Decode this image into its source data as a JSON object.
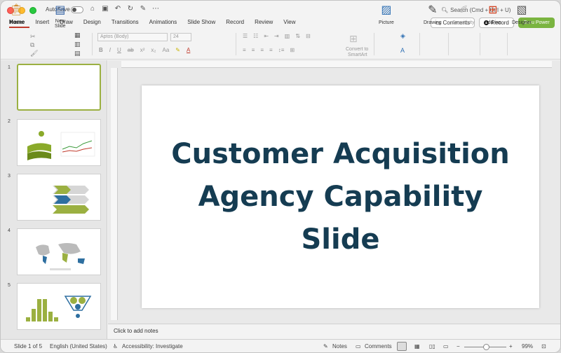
{
  "titlebar": {
    "autosave_label": "AutoSave",
    "search_placeholder": "Search (Cmd + Ctrl + U)"
  },
  "tabs": [
    {
      "label": "Home",
      "active": true
    },
    {
      "label": "Insert"
    },
    {
      "label": "Draw"
    },
    {
      "label": "Design"
    },
    {
      "label": "Transitions"
    },
    {
      "label": "Animations"
    },
    {
      "label": "Slide Show"
    },
    {
      "label": "Record"
    },
    {
      "label": "Review"
    },
    {
      "label": "View"
    }
  ],
  "top_buttons": {
    "comments": "Comments",
    "record": "Record",
    "guru": "Guru Power"
  },
  "ribbon": {
    "paste": "Paste",
    "new_slide_line1": "New",
    "new_slide_line2": "Slide",
    "font_name": "Aptos (Body)",
    "font_size": "24",
    "convert_line1": "Convert to",
    "convert_line2": "SmartArt",
    "picture": "Picture",
    "drawing": "Drawing",
    "sensitivity": "Sensitivity",
    "addins": "Add-ins",
    "designer": "Designer"
  },
  "slides": [
    {
      "number": "1"
    },
    {
      "number": "2"
    },
    {
      "number": "3"
    },
    {
      "number": "4"
    },
    {
      "number": "5"
    }
  ],
  "slide": {
    "title_line1": "Customer Acquisition",
    "title_line2": "Agency Capability",
    "title_line3": "Slide",
    "title_color": "#153c52"
  },
  "notes_placeholder": "Click to add notes",
  "status": {
    "slide_of": "Slide 1 of 5",
    "language": "English (United States)",
    "accessibility": "Accessibility: Investigate",
    "notes": "Notes",
    "comments": "Comments",
    "zoom": "99%"
  },
  "colors": {
    "accent_green": "#9bb041",
    "brand_button": "#7ab440",
    "active_tab_underline": "#c0392b"
  }
}
